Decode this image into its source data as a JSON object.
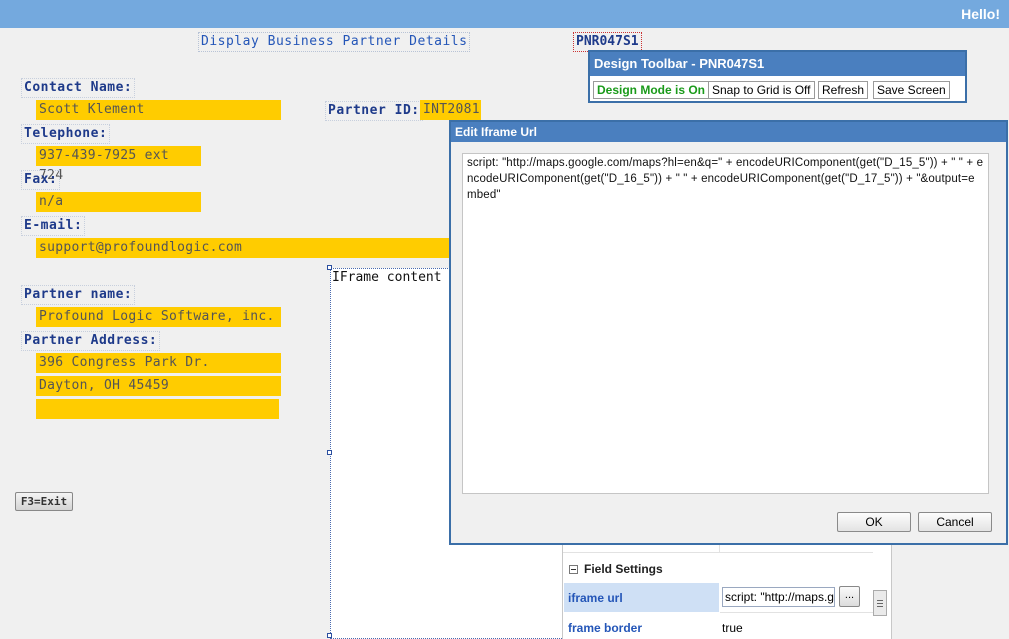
{
  "header": {
    "greeting": "Hello!"
  },
  "screen": {
    "title": "Display Business Partner Details",
    "record_name": "PNR047S1"
  },
  "fields": {
    "contact_name_label": "Contact Name:",
    "contact_name_value": "Scott Klement",
    "partner_id_label": "Partner ID:",
    "partner_id_value": "INT2081",
    "telephone_label": "Telephone:",
    "telephone_value": "937-439-7925 ext 724",
    "fax_label": "Fax:",
    "fax_value": "n/a",
    "email_label": "E-mail:",
    "email_value": "support@profoundlogic.com",
    "partner_name_label": "Partner name:",
    "partner_name_value": "Profound Logic Software, inc.",
    "partner_address_label": "Partner Address:",
    "address_line1": "396 Congress Park Dr.",
    "address_line2": "Dayton, OH  45459",
    "address_line3": ""
  },
  "iframe": {
    "content_label": "IFrame content"
  },
  "function_keys": {
    "exit_label": "F3=Exit"
  },
  "design_toolbar": {
    "title": "Design Toolbar - PNR047S1",
    "design_mode_label": "Design Mode is On",
    "snap_label": "Snap to Grid is Off",
    "refresh_label": "Refresh",
    "save_label": "Save Screen"
  },
  "properties": {
    "section_label": "Field Settings",
    "rows": [
      {
        "name": "iframe url",
        "value": "script: \"http://maps.g",
        "button": "..."
      },
      {
        "name": "frame border",
        "value": "true"
      }
    ]
  },
  "dialog": {
    "title": "Edit Iframe Url",
    "text": "script: \"http://maps.google.com/maps?hl=en&q=\" + encodeURIComponent(get(\"D_15_5\")) + \" \" + encodeURIComponent(get(\"D_16_5\")) + \" \" + encodeURIComponent(get(\"D_17_5\")) + \"&output=embed\"",
    "ok_label": "OK",
    "cancel_label": "Cancel"
  },
  "colors": {
    "header_bar": "#74a9de",
    "field_highlight": "#ffcc00",
    "label_text": "#1e3a8a",
    "window_title": "#4a7fbf",
    "design_mode_on": "#1a9a1a"
  }
}
